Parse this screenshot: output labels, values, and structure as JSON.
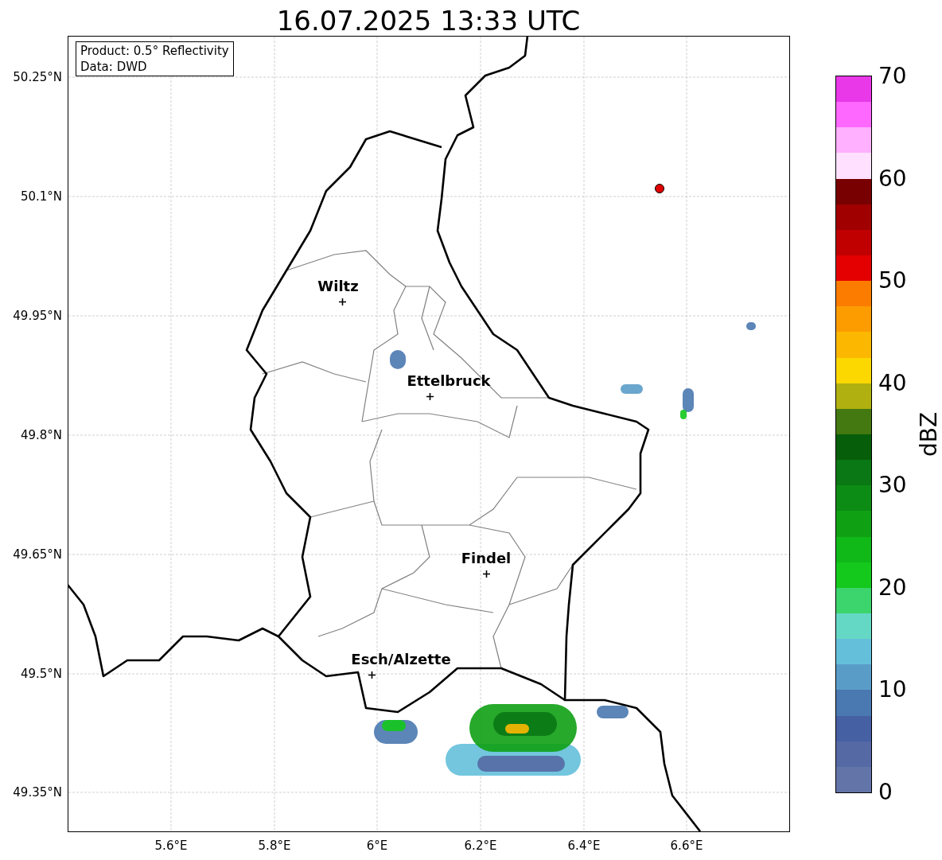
{
  "title": "16.07.2025 13:33 UTC",
  "info_box": [
    "Product: 0.5° Reflectivity",
    "Data: DWD"
  ],
  "places": [
    {
      "name": "Wiltz"
    },
    {
      "name": "Ettelbruck"
    },
    {
      "name": "Findel"
    },
    {
      "name": "Esch/Alzette"
    }
  ],
  "y_ticks": [
    "50.25°N",
    "50.1°N",
    "49.95°N",
    "49.8°N",
    "49.65°N",
    "49.5°N",
    "49.35°N"
  ],
  "x_ticks": [
    "5.6°E",
    "5.8°E",
    "6°E",
    "6.2°E",
    "6.4°E",
    "6.6°E"
  ],
  "colorbar": {
    "label": "dBZ",
    "ticks": [
      "70",
      "60",
      "50",
      "40",
      "30",
      "20",
      "10",
      "0"
    ],
    "segments": [
      {
        "color": "#e838e8"
      },
      {
        "color": "#ff68ff"
      },
      {
        "color": "#ffb0ff"
      },
      {
        "color": "#ffe0ff"
      },
      {
        "color": "#780000"
      },
      {
        "color": "#a00000"
      },
      {
        "color": "#c00000"
      },
      {
        "color": "#e40000"
      },
      {
        "color": "#fc7c00"
      },
      {
        "color": "#fc9c00"
      },
      {
        "color": "#fcb800"
      },
      {
        "color": "#fcd800"
      },
      {
        "color": "#b0b010"
      },
      {
        "color": "#447810"
      },
      {
        "color": "#065e0a"
      },
      {
        "color": "#0a7814"
      },
      {
        "color": "#0c8c14"
      },
      {
        "color": "#10a014"
      },
      {
        "color": "#10b818"
      },
      {
        "color": "#14c81c"
      },
      {
        "color": "#3cd46c"
      },
      {
        "color": "#64d8c4"
      },
      {
        "color": "#64c0da"
      },
      {
        "color": "#5a9cc8"
      },
      {
        "color": "#4a78b0"
      },
      {
        "color": "#4660a4"
      },
      {
        "color": "#5569a4"
      },
      {
        "color": "#6374a8"
      }
    ]
  }
}
